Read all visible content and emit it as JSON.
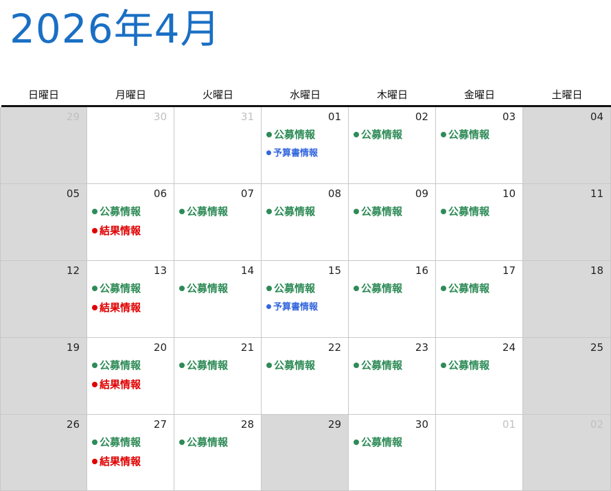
{
  "page": {
    "title": "2026年4月"
  },
  "colors": {
    "title": "#1a6fc4",
    "koubo": "#2e8b57",
    "kekka": "#e00000",
    "yosan": "#3366dd",
    "gray_cell": "#d9d9d9"
  },
  "weekdays": [
    "日曜日",
    "月曜日",
    "火曜日",
    "水曜日",
    "木曜日",
    "金曜日",
    "土曜日"
  ],
  "event_types": {
    "koubo": {
      "label": "公募情報",
      "color": "#2e8b57",
      "small": false
    },
    "kekka": {
      "label": "結果情報",
      "color": "#e00000",
      "small": false
    },
    "yosan": {
      "label": "予算書情報",
      "color": "#3366dd",
      "small": true
    }
  },
  "weeks": [
    [
      {
        "day": "29",
        "muted": true,
        "gray": true,
        "events": []
      },
      {
        "day": "30",
        "muted": true,
        "gray": false,
        "events": []
      },
      {
        "day": "31",
        "muted": true,
        "gray": false,
        "events": []
      },
      {
        "day": "01",
        "muted": false,
        "gray": false,
        "events": [
          "koubo",
          "yosan"
        ]
      },
      {
        "day": "02",
        "muted": false,
        "gray": false,
        "events": [
          "koubo"
        ]
      },
      {
        "day": "03",
        "muted": false,
        "gray": false,
        "events": [
          "koubo"
        ]
      },
      {
        "day": "04",
        "muted": false,
        "gray": true,
        "events": []
      }
    ],
    [
      {
        "day": "05",
        "muted": false,
        "gray": true,
        "events": []
      },
      {
        "day": "06",
        "muted": false,
        "gray": false,
        "events": [
          "koubo",
          "kekka"
        ]
      },
      {
        "day": "07",
        "muted": false,
        "gray": false,
        "events": [
          "koubo"
        ]
      },
      {
        "day": "08",
        "muted": false,
        "gray": false,
        "events": [
          "koubo"
        ]
      },
      {
        "day": "09",
        "muted": false,
        "gray": false,
        "events": [
          "koubo"
        ]
      },
      {
        "day": "10",
        "muted": false,
        "gray": false,
        "events": [
          "koubo"
        ]
      },
      {
        "day": "11",
        "muted": false,
        "gray": true,
        "events": []
      }
    ],
    [
      {
        "day": "12",
        "muted": false,
        "gray": true,
        "events": []
      },
      {
        "day": "13",
        "muted": false,
        "gray": false,
        "events": [
          "koubo",
          "kekka"
        ]
      },
      {
        "day": "14",
        "muted": false,
        "gray": false,
        "events": [
          "koubo"
        ]
      },
      {
        "day": "15",
        "muted": false,
        "gray": false,
        "events": [
          "koubo",
          "yosan"
        ]
      },
      {
        "day": "16",
        "muted": false,
        "gray": false,
        "events": [
          "koubo"
        ]
      },
      {
        "day": "17",
        "muted": false,
        "gray": false,
        "events": [
          "koubo"
        ]
      },
      {
        "day": "18",
        "muted": false,
        "gray": true,
        "events": []
      }
    ],
    [
      {
        "day": "19",
        "muted": false,
        "gray": true,
        "events": []
      },
      {
        "day": "20",
        "muted": false,
        "gray": false,
        "events": [
          "koubo",
          "kekka"
        ]
      },
      {
        "day": "21",
        "muted": false,
        "gray": false,
        "events": [
          "koubo"
        ]
      },
      {
        "day": "22",
        "muted": false,
        "gray": false,
        "events": [
          "koubo"
        ]
      },
      {
        "day": "23",
        "muted": false,
        "gray": false,
        "events": [
          "koubo"
        ]
      },
      {
        "day": "24",
        "muted": false,
        "gray": false,
        "events": [
          "koubo"
        ]
      },
      {
        "day": "25",
        "muted": false,
        "gray": true,
        "events": []
      }
    ],
    [
      {
        "day": "26",
        "muted": false,
        "gray": true,
        "events": []
      },
      {
        "day": "27",
        "muted": false,
        "gray": false,
        "events": [
          "koubo",
          "kekka"
        ]
      },
      {
        "day": "28",
        "muted": false,
        "gray": false,
        "events": [
          "koubo"
        ]
      },
      {
        "day": "29",
        "muted": false,
        "gray": true,
        "events": []
      },
      {
        "day": "30",
        "muted": false,
        "gray": false,
        "events": [
          "koubo"
        ]
      },
      {
        "day": "01",
        "muted": true,
        "gray": false,
        "events": []
      },
      {
        "day": "02",
        "muted": true,
        "gray": true,
        "events": []
      }
    ]
  ]
}
